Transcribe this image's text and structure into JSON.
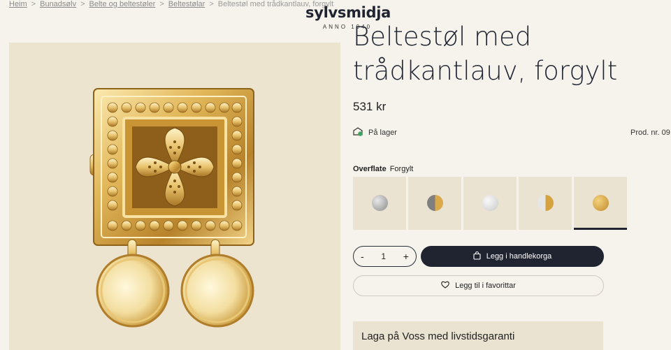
{
  "breadcrumb": {
    "items": [
      "Heim",
      "Bunadsølv",
      "Belte og beltestøler",
      "Beltestølar"
    ],
    "current": "Beltestøl med trådkantlauv, forgylt"
  },
  "logo": {
    "name": "sylvsmidja",
    "tagline": "ANNO 1940"
  },
  "product": {
    "title": "Beltestøl med trådkantlauv, forgylt",
    "price": "531 kr",
    "stock": "På lager",
    "product_number": "Prod. nr. 09"
  },
  "finish": {
    "label": "Overflate",
    "selected": "Forgylt",
    "swatch_colors": [
      "silver",
      "silver-gold",
      "white-silver",
      "silver-gold-right",
      "gold"
    ],
    "active_index": 4
  },
  "cart": {
    "minus": "-",
    "quantity": "1",
    "plus": "+",
    "add_label": "Legg i handlekorga",
    "favorite_label": "Legg til i favorittar"
  },
  "info": {
    "heading": "Laga på Voss med livstidsgaranti"
  },
  "colors": {
    "primary": "#1f2430",
    "background": "#f6f3ec",
    "panel": "#ede4d0",
    "stock_green": "#3aa35c"
  }
}
